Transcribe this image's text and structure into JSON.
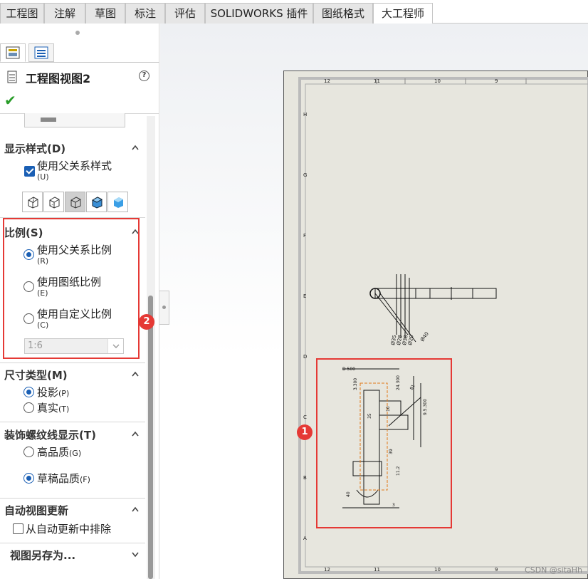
{
  "tabs": [
    "工程图",
    "注解",
    "草图",
    "标注",
    "评估",
    "SOLIDWORKS 插件",
    "图纸格式",
    "大工程师"
  ],
  "active_tab": "大工程师",
  "panel": {
    "title": "工程图视图2",
    "help": "?",
    "ok": "✔",
    "display_style": {
      "title": "显示样式(D)",
      "use_parent": "使用父关系样式",
      "use_parent_key": "(U)",
      "use_parent_checked": true
    },
    "scale": {
      "title": "比例(S)",
      "options": [
        {
          "label": "使用父关系比例",
          "key": "(R)",
          "selected": true
        },
        {
          "label": "使用图纸比例",
          "key": "(E)",
          "selected": false
        },
        {
          "label": "使用自定义比例",
          "key": "(C)",
          "selected": false
        }
      ],
      "custom_value": "1:6"
    },
    "dim_type": {
      "title": "尺寸类型(M)",
      "options": [
        {
          "label": "投影",
          "key": "(P)",
          "selected": true
        },
        {
          "label": "真实",
          "key": "(T)",
          "selected": false
        }
      ]
    },
    "thread": {
      "title": "装饰螺纹线显示(T)",
      "options": [
        {
          "label": "高品质",
          "key": "(G)",
          "selected": false
        },
        {
          "label": "草稿品质",
          "key": "(F)",
          "selected": true
        }
      ]
    },
    "auto_update": {
      "title": "自动视图更新",
      "exclude": "从自动更新中排除",
      "exclude_checked": false
    },
    "save_as": {
      "title": "视图另存为..."
    }
  },
  "annotations": {
    "badge1": "1",
    "badge2": "2"
  },
  "sheet": {
    "top_numbers": [
      "12",
      "11",
      "10",
      "9"
    ],
    "bottom_numbers": [
      "12",
      "11",
      "10",
      "9"
    ],
    "side_letters": [
      "H",
      "G",
      "F",
      "E",
      "D",
      "C",
      "B",
      "A"
    ],
    "top_view_dims": [
      "Ø35",
      "Ø28",
      "Ø38",
      "Ø20",
      "Ø40"
    ],
    "front_view_dims": [
      "D 500",
      "3.300",
      "24.300",
      "81",
      "9.5.300",
      "10",
      "35",
      "39",
      "11.2",
      "3",
      "40"
    ]
  },
  "watermark": "CSDN @sitaHh"
}
